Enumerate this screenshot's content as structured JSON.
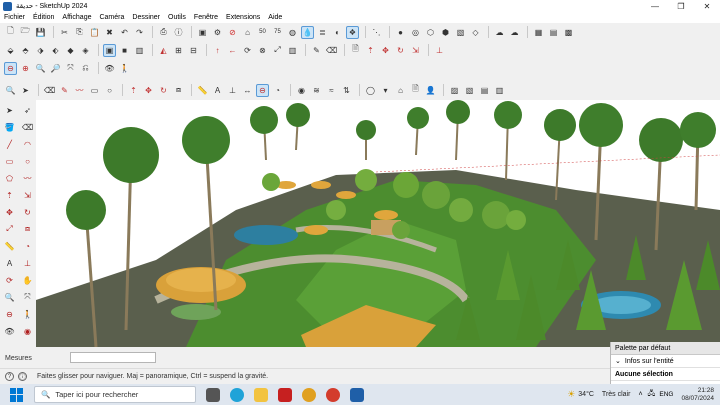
{
  "titlebar": {
    "title": "حديقة - SketchUp 2024"
  },
  "menubar": {
    "items": [
      "Fichier",
      "Édition",
      "Affichage",
      "Caméra",
      "Dessiner",
      "Outils",
      "Fenêtre",
      "Extensions",
      "Aide"
    ]
  },
  "measures": {
    "label": "Mesures",
    "value": ""
  },
  "status": {
    "text": "Faites glisser pour naviguer. Maj = panoramique, Ctrl = suspend la gravité."
  },
  "panel": {
    "title": "Palette par défaut",
    "entity_info": "Infos sur l'entité",
    "selection": "Aucune sélection"
  },
  "taskbar": {
    "search_placeholder": "Taper ici pour rechercher",
    "weather_temp": "34°C",
    "weather_desc": "Très clair",
    "time": "21:28",
    "date": "08/07/2024",
    "lang": "ENG"
  },
  "colors": {
    "accent": "#0078d4",
    "grass": "#4a8f2c",
    "roof": "#d9a13a"
  }
}
